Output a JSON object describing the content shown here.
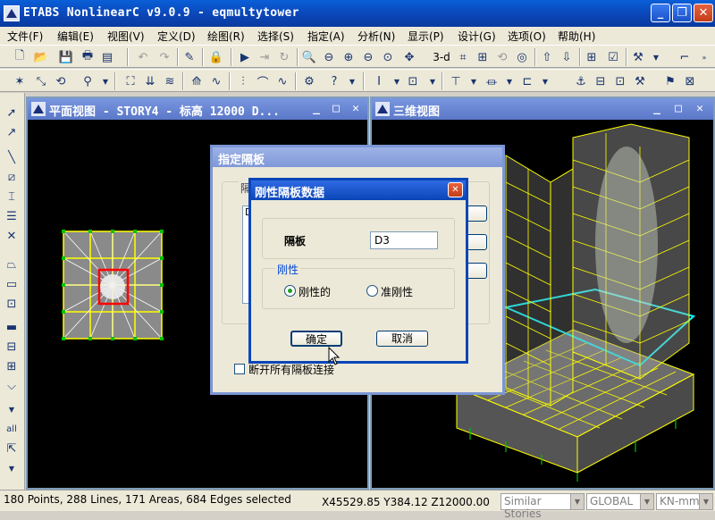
{
  "window": {
    "title": "ETABS NonlinearC v9.0.9 - eqmultytower",
    "minimize": "_",
    "restore": "❐",
    "close": "✕"
  },
  "menus": [
    {
      "label": "文件(F)"
    },
    {
      "label": "编辑(E)"
    },
    {
      "label": "视图(V)"
    },
    {
      "label": "定义(D)"
    },
    {
      "label": "绘图(R)"
    },
    {
      "label": "选择(S)"
    },
    {
      "label": "指定(A)"
    },
    {
      "label": "分析(N)"
    },
    {
      "label": "显示(P)"
    },
    {
      "label": "设计(G)"
    },
    {
      "label": "选项(O)"
    },
    {
      "label": "帮助(H)"
    }
  ],
  "toolbar1": {
    "view3d_label": "3-d"
  },
  "plan_window": {
    "title": "平面视图 - STORY4 - 标高 12000  D..."
  },
  "view3d_window": {
    "title": "三维视图"
  },
  "assign_dialog": {
    "title": "指定隔板",
    "group_label": "隔",
    "list_first": "D",
    "disconnect_label": "断开所有隔板连接",
    "disconnect_checked": false
  },
  "rigid_dialog": {
    "title": "刚性隔板数据",
    "diaphragm_label": "隔板",
    "diaphragm_value": "D3",
    "rigidity_label": "刚性",
    "rigid_option": "刚性的",
    "semirigid_option": "准刚性",
    "selected": "rigid",
    "ok_label": "确定",
    "cancel_label": "取消"
  },
  "status": {
    "selection": "180 Points, 288 Lines, 171 Areas, 684 Edges selected",
    "coords": "X45529.85  Y384.12  Z12000.00",
    "stories": "Similar Stories",
    "coord_system": "GLOBAL",
    "units": "KN-mm"
  },
  "left_toolbar": {
    "all_label": "all"
  },
  "colors": {
    "titlebar": "#0b46b8",
    "model_yellow": "#ffff00",
    "model_cyan": "#00ffff",
    "support_green": "#00c000",
    "selected_red": "#ff0000"
  }
}
